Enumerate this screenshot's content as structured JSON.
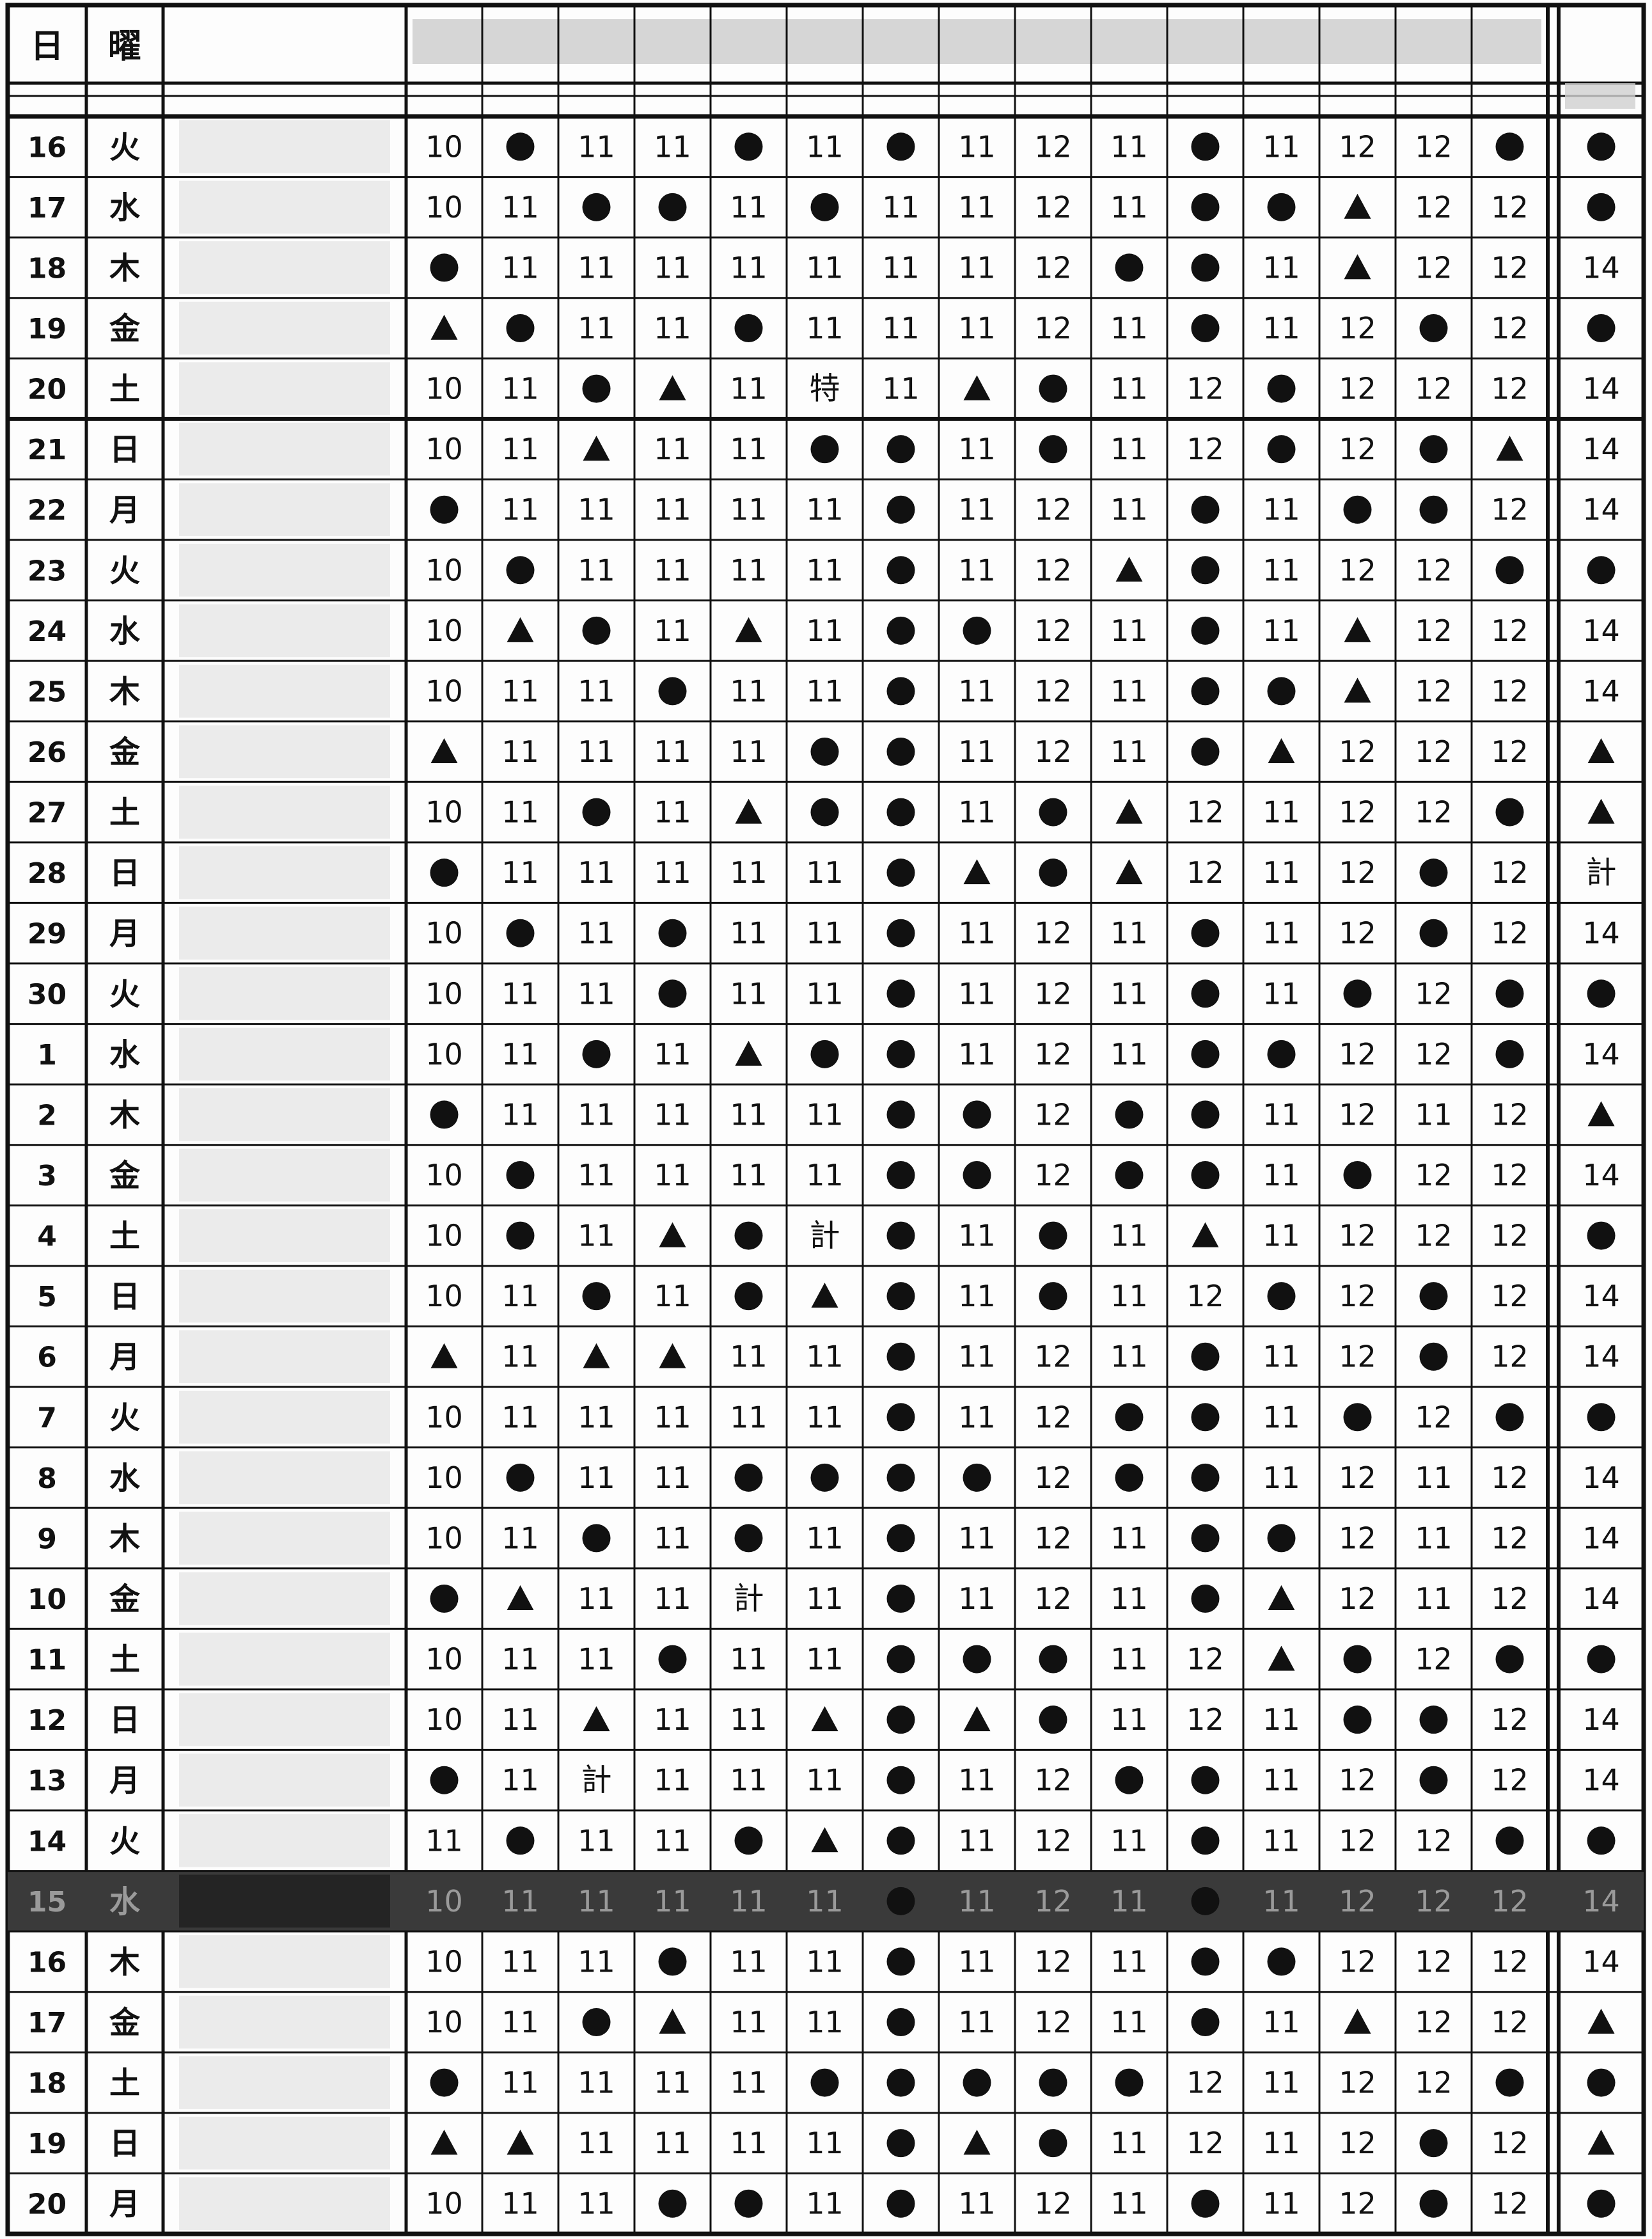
{
  "header": {
    "day_label": "日",
    "weekday_label": "曜"
  },
  "rows": [
    {
      "day": "16",
      "wd": "火",
      "cells": [
        "10",
        "●",
        "11",
        "11",
        "●",
        "11",
        "●",
        "11",
        "12",
        "11",
        "●",
        "11",
        "12",
        "12",
        "●"
      ],
      "last": "●"
    },
    {
      "day": "17",
      "wd": "水",
      "cells": [
        "10",
        "11",
        "●",
        "●",
        "11",
        "●",
        "11",
        "11",
        "12",
        "11",
        "●",
        "●",
        "▲",
        "12",
        "12"
      ],
      "last": "●"
    },
    {
      "day": "18",
      "wd": "木",
      "cells": [
        "●",
        "11",
        "11",
        "11",
        "11",
        "11",
        "11",
        "11",
        "12",
        "●",
        "●",
        "11",
        "▲",
        "12",
        "12"
      ],
      "last": "14"
    },
    {
      "day": "19",
      "wd": "金",
      "cells": [
        "▲",
        "●",
        "11",
        "11",
        "●",
        "11",
        "11",
        "11",
        "12",
        "11",
        "●",
        "11",
        "12",
        "●",
        "12"
      ],
      "last": "●"
    },
    {
      "day": "20",
      "wd": "土",
      "cells": [
        "10",
        "11",
        "●",
        "▲",
        "11",
        "特",
        "11",
        "▲",
        "●",
        "11",
        "12",
        "●",
        "12",
        "12",
        "12"
      ],
      "last": "14"
    },
    {
      "day": "21",
      "wd": "日",
      "cells": [
        "10",
        "11",
        "▲",
        "11",
        "11",
        "●",
        "●",
        "11",
        "●",
        "11",
        "12",
        "●",
        "12",
        "●",
        "▲"
      ],
      "last": "14"
    },
    {
      "day": "22",
      "wd": "月",
      "cells": [
        "●",
        "11",
        "11",
        "11",
        "11",
        "11",
        "●",
        "11",
        "12",
        "11",
        "●",
        "11",
        "●",
        "●",
        "12"
      ],
      "last": "14"
    },
    {
      "day": "23",
      "wd": "火",
      "cells": [
        "10",
        "●",
        "11",
        "11",
        "11",
        "11",
        "●",
        "11",
        "12",
        "▲",
        "●",
        "11",
        "12",
        "12",
        "●"
      ],
      "last": "●"
    },
    {
      "day": "24",
      "wd": "水",
      "cells": [
        "10",
        "▲",
        "●",
        "11",
        "▲",
        "11",
        "●",
        "●",
        "12",
        "11",
        "●",
        "11",
        "▲",
        "12",
        "12"
      ],
      "last": "14"
    },
    {
      "day": "25",
      "wd": "木",
      "cells": [
        "10",
        "11",
        "11",
        "●",
        "11",
        "11",
        "●",
        "11",
        "12",
        "11",
        "●",
        "●",
        "▲",
        "12",
        "12"
      ],
      "last": "14"
    },
    {
      "day": "26",
      "wd": "金",
      "cells": [
        "▲",
        "11",
        "11",
        "11",
        "11",
        "●",
        "●",
        "11",
        "12",
        "11",
        "●",
        "▲",
        "12",
        "12",
        "12"
      ],
      "last": "▲"
    },
    {
      "day": "27",
      "wd": "土",
      "cells": [
        "10",
        "11",
        "●",
        "11",
        "▲",
        "●",
        "●",
        "11",
        "●",
        "▲",
        "12",
        "11",
        "12",
        "12",
        "●"
      ],
      "last": "▲"
    },
    {
      "day": "28",
      "wd": "日",
      "cells": [
        "●",
        "11",
        "11",
        "11",
        "11",
        "11",
        "●",
        "▲",
        "●",
        "▲",
        "12",
        "11",
        "12",
        "●",
        "12"
      ],
      "last": "計"
    },
    {
      "day": "29",
      "wd": "月",
      "cells": [
        "10",
        "●",
        "11",
        "●",
        "11",
        "11",
        "●",
        "11",
        "12",
        "11",
        "●",
        "11",
        "12",
        "●",
        "12"
      ],
      "last": "14"
    },
    {
      "day": "30",
      "wd": "火",
      "cells": [
        "10",
        "11",
        "11",
        "●",
        "11",
        "11",
        "●",
        "11",
        "12",
        "11",
        "●",
        "11",
        "●",
        "12",
        "●"
      ],
      "last": "●"
    },
    {
      "day": "1",
      "wd": "水",
      "cells": [
        "10",
        "11",
        "●",
        "11",
        "▲",
        "●",
        "●",
        "11",
        "12",
        "11",
        "●",
        "●",
        "12",
        "12",
        "●"
      ],
      "last": "14"
    },
    {
      "day": "2",
      "wd": "木",
      "cells": [
        "●",
        "11",
        "11",
        "11",
        "11",
        "11",
        "●",
        "●",
        "12",
        "●",
        "●",
        "11",
        "12",
        "11",
        "12"
      ],
      "last": "▲"
    },
    {
      "day": "3",
      "wd": "金",
      "cells": [
        "10",
        "●",
        "11",
        "11",
        "11",
        "11",
        "●",
        "●",
        "12",
        "●",
        "●",
        "11",
        "●",
        "12",
        "12"
      ],
      "last": "14"
    },
    {
      "day": "4",
      "wd": "土",
      "cells": [
        "10",
        "●",
        "11",
        "▲",
        "●",
        "計",
        "●",
        "11",
        "●",
        "11",
        "▲",
        "11",
        "12",
        "12",
        "12"
      ],
      "last": "●"
    },
    {
      "day": "5",
      "wd": "日",
      "cells": [
        "10",
        "11",
        "●",
        "11",
        "●",
        "▲",
        "●",
        "11",
        "●",
        "11",
        "12",
        "●",
        "12",
        "●",
        "12"
      ],
      "last": "14"
    },
    {
      "day": "6",
      "wd": "月",
      "cells": [
        "▲",
        "11",
        "▲",
        "▲",
        "11",
        "11",
        "●",
        "11",
        "12",
        "11",
        "●",
        "11",
        "12",
        "●",
        "12"
      ],
      "last": "14"
    },
    {
      "day": "7",
      "wd": "火",
      "cells": [
        "10",
        "11",
        "11",
        "11",
        "11",
        "11",
        "●",
        "11",
        "12",
        "●",
        "●",
        "11",
        "●",
        "12",
        "●"
      ],
      "last": "●"
    },
    {
      "day": "8",
      "wd": "水",
      "cells": [
        "10",
        "●",
        "11",
        "11",
        "●",
        "●",
        "●",
        "●",
        "12",
        "●",
        "●",
        "11",
        "12",
        "11",
        "12"
      ],
      "last": "14"
    },
    {
      "day": "9",
      "wd": "木",
      "cells": [
        "10",
        "11",
        "●",
        "11",
        "●",
        "11",
        "●",
        "11",
        "12",
        "11",
        "●",
        "●",
        "12",
        "11",
        "12"
      ],
      "last": "14"
    },
    {
      "day": "10",
      "wd": "金",
      "cells": [
        "●",
        "▲",
        "11",
        "11",
        "計",
        "11",
        "●",
        "11",
        "12",
        "11",
        "●",
        "▲",
        "12",
        "11",
        "12"
      ],
      "last": "14"
    },
    {
      "day": "11",
      "wd": "土",
      "cells": [
        "10",
        "11",
        "11",
        "●",
        "11",
        "11",
        "●",
        "●",
        "●",
        "11",
        "12",
        "▲",
        "●",
        "12",
        "●"
      ],
      "last": "●"
    },
    {
      "day": "12",
      "wd": "日",
      "cells": [
        "10",
        "11",
        "▲",
        "11",
        "11",
        "▲",
        "●",
        "▲",
        "●",
        "11",
        "12",
        "11",
        "●",
        "●",
        "12"
      ],
      "last": "14"
    },
    {
      "day": "13",
      "wd": "月",
      "cells": [
        "●",
        "11",
        "計",
        "11",
        "11",
        "11",
        "●",
        "11",
        "12",
        "●",
        "●",
        "11",
        "12",
        "●",
        "12"
      ],
      "last": "14"
    },
    {
      "day": "14",
      "wd": "火",
      "cells": [
        "11",
        "●",
        "11",
        "11",
        "●",
        "▲",
        "●",
        "11",
        "12",
        "11",
        "●",
        "11",
        "12",
        "12",
        "●"
      ],
      "last": "●"
    },
    {
      "day": "15",
      "wd": "水",
      "highlight": true,
      "cells": [
        "10",
        "11",
        "11",
        "11",
        "11",
        "11",
        "●",
        "11",
        "12",
        "11",
        "●",
        "11",
        "12",
        "12",
        "12"
      ],
      "last": "14"
    },
    {
      "day": "16",
      "wd": "木",
      "cells": [
        "10",
        "11",
        "11",
        "●",
        "11",
        "11",
        "●",
        "11",
        "12",
        "11",
        "●",
        "●",
        "12",
        "12",
        "12"
      ],
      "last": "14"
    },
    {
      "day": "17",
      "wd": "金",
      "cells": [
        "10",
        "11",
        "●",
        "▲",
        "11",
        "11",
        "●",
        "11",
        "12",
        "11",
        "●",
        "11",
        "▲",
        "12",
        "12"
      ],
      "last": "▲"
    },
    {
      "day": "18",
      "wd": "土",
      "cells": [
        "●",
        "11",
        "11",
        "11",
        "11",
        "●",
        "●",
        "●",
        "●",
        "●",
        "12",
        "11",
        "12",
        "12",
        "●"
      ],
      "last": "●"
    },
    {
      "day": "19",
      "wd": "日",
      "cells": [
        "▲",
        "▲",
        "11",
        "11",
        "11",
        "11",
        "●",
        "▲",
        "●",
        "11",
        "12",
        "11",
        "12",
        "●",
        "12"
      ],
      "last": "▲"
    },
    {
      "day": "20",
      "wd": "月",
      "cells": [
        "10",
        "11",
        "11",
        "●",
        "●",
        "11",
        "●",
        "11",
        "12",
        "11",
        "●",
        "11",
        "12",
        "●",
        "12"
      ],
      "last": "●"
    }
  ],
  "colors": {
    "ink": "#111111",
    "paper": "#fdfdfd",
    "highlight_row": "#3a3a3a",
    "blur": "#cfcfcf"
  }
}
